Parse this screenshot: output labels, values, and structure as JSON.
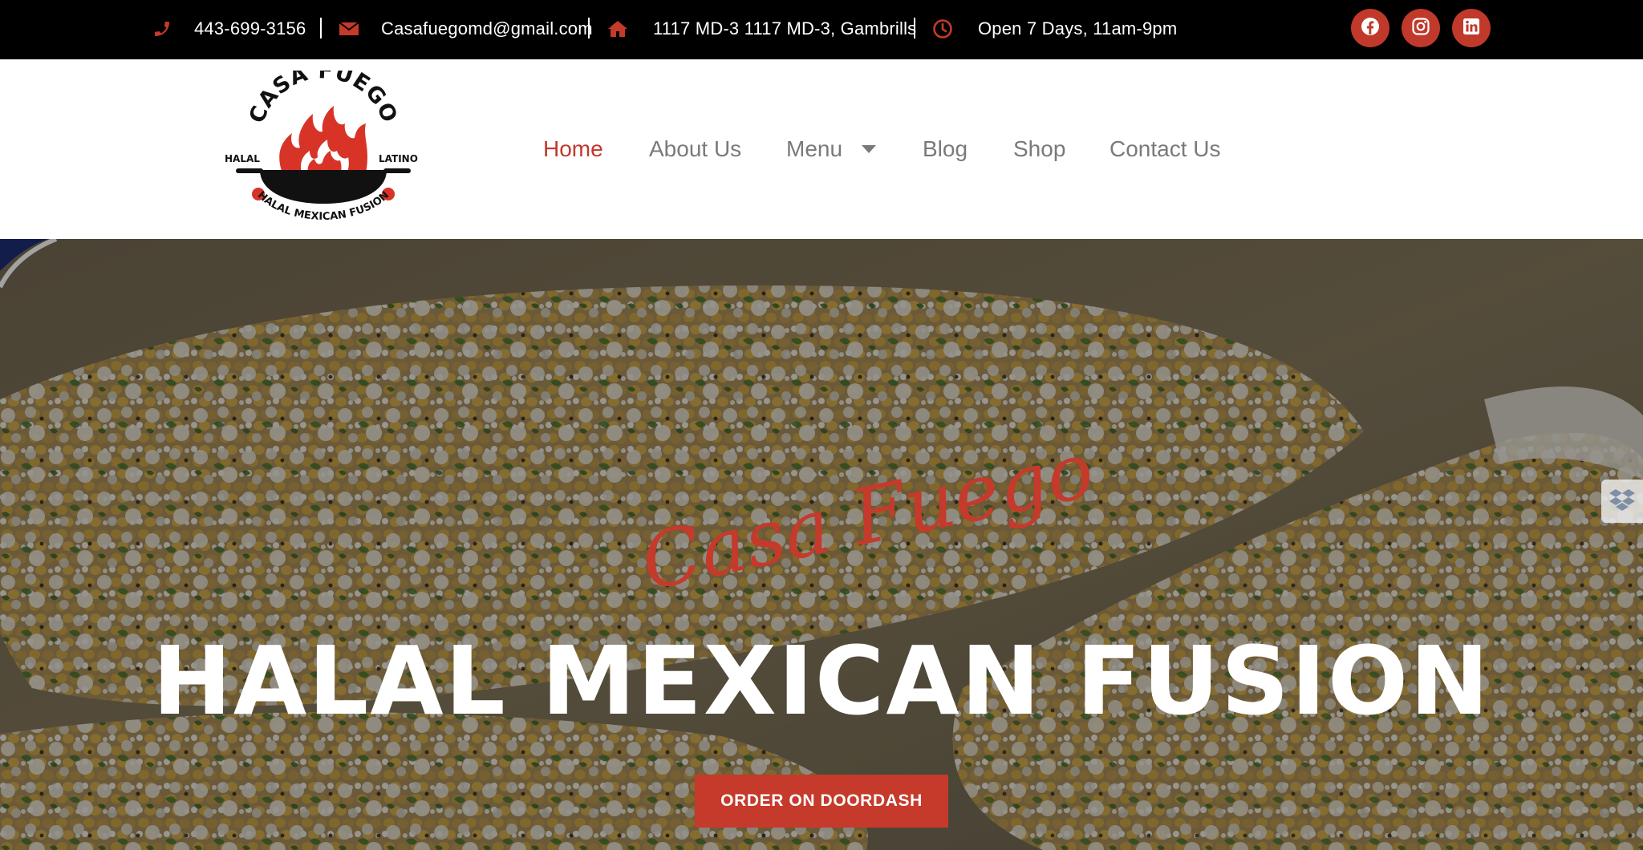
{
  "topbar": {
    "phone": "443-699-3156",
    "email": "Casafuegomd@gmail.com",
    "address": "1117 MD-3 1117 MD-3, Gambrills",
    "hours": "Open 7 Days, 11am-9pm",
    "icons": [
      "phone-icon",
      "envelope-icon",
      "home-icon",
      "clock-icon"
    ],
    "social": [
      "facebook-icon",
      "instagram-icon",
      "linkedin-icon"
    ]
  },
  "logo": {
    "title": "CASA FUEGO",
    "left_text": "HALAL",
    "right_text": "LATINO",
    "bottom_text": "HALAL MEXICAN FUSION"
  },
  "nav": {
    "items": [
      {
        "label": "Home",
        "active": true
      },
      {
        "label": "About Us"
      },
      {
        "label": "Menu",
        "has_dropdown": true
      },
      {
        "label": "Blog"
      },
      {
        "label": "Shop"
      },
      {
        "label": "Contact Us"
      }
    ]
  },
  "hero": {
    "script_title": "Casa Fuego",
    "title": "HALAL MEXICAN FUSION",
    "cta_label": "ORDER ON DOORDASH"
  },
  "colors": {
    "accent": "#c53a2b",
    "topbar_bg": "#000000",
    "nav_text": "#7a7a7a"
  }
}
